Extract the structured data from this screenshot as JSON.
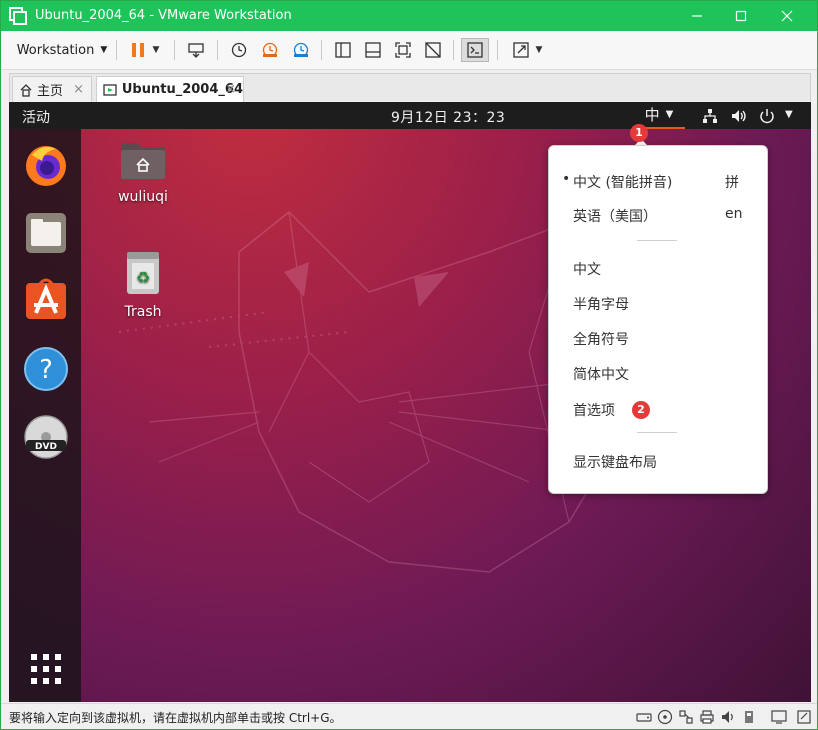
{
  "window": {
    "title": "Ubuntu_2004_64 - VMware Workstation",
    "accent": "#1ec35a"
  },
  "toolbar": {
    "workstation_label": "Workstation"
  },
  "tabs": [
    {
      "label": "主页"
    },
    {
      "label": "Ubuntu_2004_64"
    }
  ],
  "tab_close": "×",
  "gnome": {
    "activities": "活动",
    "clock": "9月12日  23：23",
    "input_method": "中"
  },
  "desktop": {
    "icons": [
      {
        "label": "wuliuqi",
        "icon": "home-folder-icon"
      },
      {
        "label": "Trash",
        "icon": "trash-icon"
      }
    ]
  },
  "dock": {
    "items": [
      "firefox-icon",
      "files-icon",
      "software-center-icon",
      "help-icon",
      "dvd-icon",
      "show-applications-icon"
    ]
  },
  "im_menu": {
    "engines": [
      {
        "label": "中文 (智能拼音)",
        "key": "拼",
        "selected": true
      },
      {
        "label": "英语（美国）",
        "key": "en",
        "selected": false
      }
    ],
    "options": [
      {
        "label": "中文"
      },
      {
        "label": "半角字母"
      },
      {
        "label": "全角符号"
      },
      {
        "label": "简体中文"
      },
      {
        "label": "首选项"
      }
    ],
    "keyboard_layout": "显示键盘布局",
    "selected_marker": "•"
  },
  "badges": [
    "1",
    "2"
  ],
  "status": {
    "text": "要将输入定向到该虚拟机，请在虚拟机内部单击或按 Ctrl+G。"
  }
}
